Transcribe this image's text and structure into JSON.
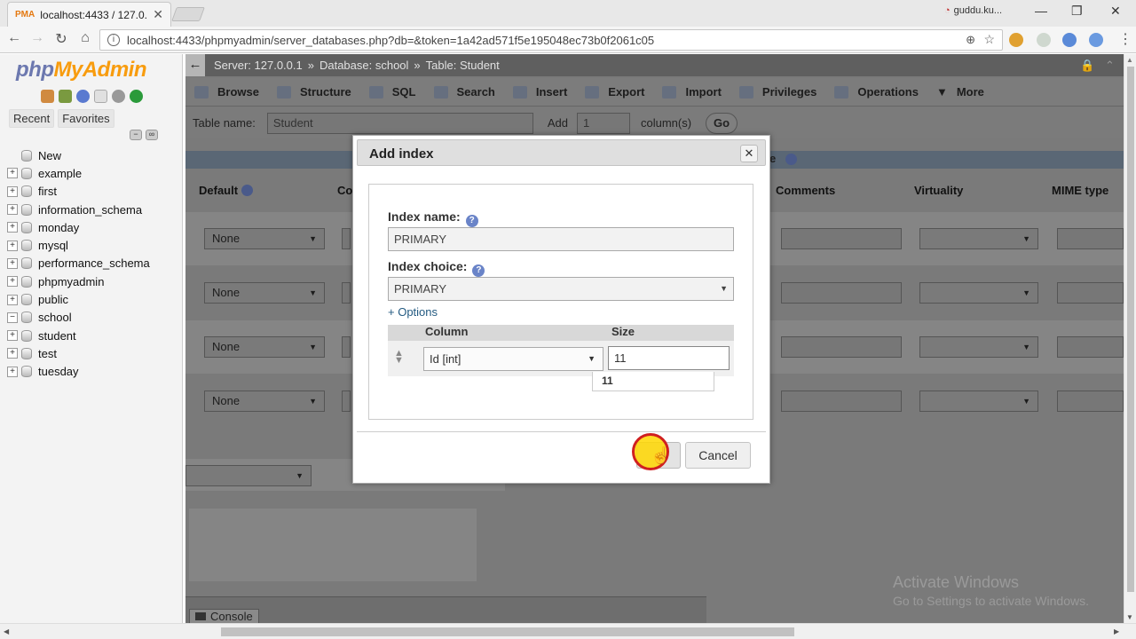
{
  "browser": {
    "tab_title": "localhost:4433 / 127.0.0.",
    "tab_close": "✕",
    "profile_name": "guddu.ku...",
    "url": "localhost:4433/phpmyadmin/server_databases.php?db=&token=1a42ad571f5e195048ec73b0f2061c05",
    "nav": {
      "back": "←",
      "forward": "→",
      "reload": "↻",
      "home": "⌂"
    },
    "window_controls": {
      "minimize": "—",
      "restore": "❐",
      "close": "✕"
    }
  },
  "logo": {
    "php": "php",
    "my": "MyAdmin"
  },
  "sidebar": {
    "tabs": [
      "Recent",
      "Favorites"
    ],
    "tree": [
      {
        "label": "New",
        "expander": ""
      },
      {
        "label": "example",
        "expander": "+"
      },
      {
        "label": "first",
        "expander": "+"
      },
      {
        "label": "information_schema",
        "expander": "+"
      },
      {
        "label": "monday",
        "expander": "+"
      },
      {
        "label": "mysql",
        "expander": "+"
      },
      {
        "label": "performance_schema",
        "expander": "+"
      },
      {
        "label": "phpmyadmin",
        "expander": "+"
      },
      {
        "label": "public",
        "expander": "+"
      },
      {
        "label": "school",
        "expander": "−"
      },
      {
        "label": "student",
        "expander": "+"
      },
      {
        "label": "test",
        "expander": "+"
      },
      {
        "label": "tuesday",
        "expander": "+"
      }
    ]
  },
  "breadcrumb": {
    "back": "←",
    "server": "Server: 127.0.0.1",
    "database": "Database: school",
    "table": "Table: Student",
    "sep": "»"
  },
  "menu_tabs": [
    "Browse",
    "Structure",
    "SQL",
    "Search",
    "Insert",
    "Export",
    "Import",
    "Privileges",
    "Operations",
    "More"
  ],
  "table_row": {
    "name_label": "Table name:",
    "name_value": "Student",
    "add_label": "Add",
    "add_value": "1",
    "columns_label": "column(s)",
    "go": "Go"
  },
  "bluebar_fragment": "e",
  "columns": {
    "default": "Default",
    "co": "Co",
    "comments": "Comments",
    "virtuality": "Virtuality",
    "mime": "MIME type"
  },
  "default_select": "None",
  "console_label": "Console",
  "dialog": {
    "title": "Add index",
    "close": "✕",
    "index_name_label": "Index name:",
    "index_name_value": "PRIMARY",
    "index_choice_label": "Index choice:",
    "index_choice_value": "PRIMARY",
    "options_link": "+ Options",
    "column_header": "Column",
    "size_header": "Size",
    "column_value": "Id [int]",
    "size_value": "11",
    "autocomplete_value": "11",
    "cancel": "Cancel"
  },
  "watermark": {
    "line1": "Activate Windows",
    "line2": "Go to Settings to activate Windows."
  },
  "colors": {
    "pma_blue": "#6c78af",
    "pma_orange": "#f89c0e",
    "overlay_gray": "#7a7a7a",
    "cursor_ring": "#d02020",
    "cursor_fill": "#ffd700"
  }
}
